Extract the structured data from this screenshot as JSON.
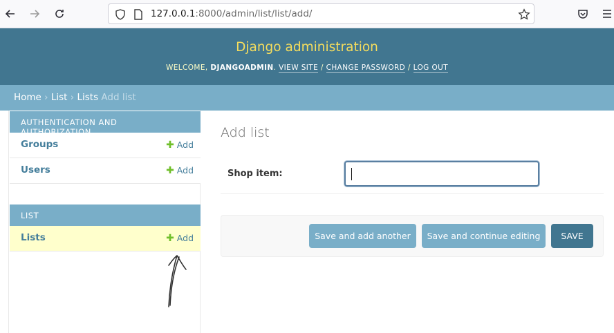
{
  "browser": {
    "url_host": "127.0.0.1",
    "url_rest": ":8000/admin/list/list/add/"
  },
  "header": {
    "site_name": "Django administration",
    "welcome": "WELCOME,",
    "username": "DJANGOADMIN",
    "view_site": "VIEW SITE",
    "change_password": "CHANGE PASSWORD",
    "log_out": "LOG OUT",
    "separator": "/"
  },
  "breadcrumbs": {
    "home": "Home",
    "app": "List",
    "model": "Lists",
    "current": "Add list",
    "separator": "›"
  },
  "sidebar": {
    "modules": [
      {
        "caption": "AUTHENTICATION AND AUTHORIZATION",
        "models": [
          {
            "name": "Groups",
            "add": "Add"
          },
          {
            "name": "Users",
            "add": "Add"
          }
        ]
      },
      {
        "caption": "LIST",
        "models": [
          {
            "name": "Lists",
            "add": "Add"
          }
        ]
      }
    ]
  },
  "content": {
    "title": "Add list",
    "field_label": "Shop item:",
    "field_value": ""
  },
  "submit": {
    "save_add_another": "Save and add another",
    "save_continue": "Save and continue editing",
    "save": "SAVE"
  },
  "colors": {
    "header_bg": "#417690",
    "branding": "#f5dd5d",
    "breadcrumb_bg": "#79aec8",
    "link": "#447e9b",
    "add_plus": "#70bf2b",
    "current_row": "#ffffcc"
  }
}
